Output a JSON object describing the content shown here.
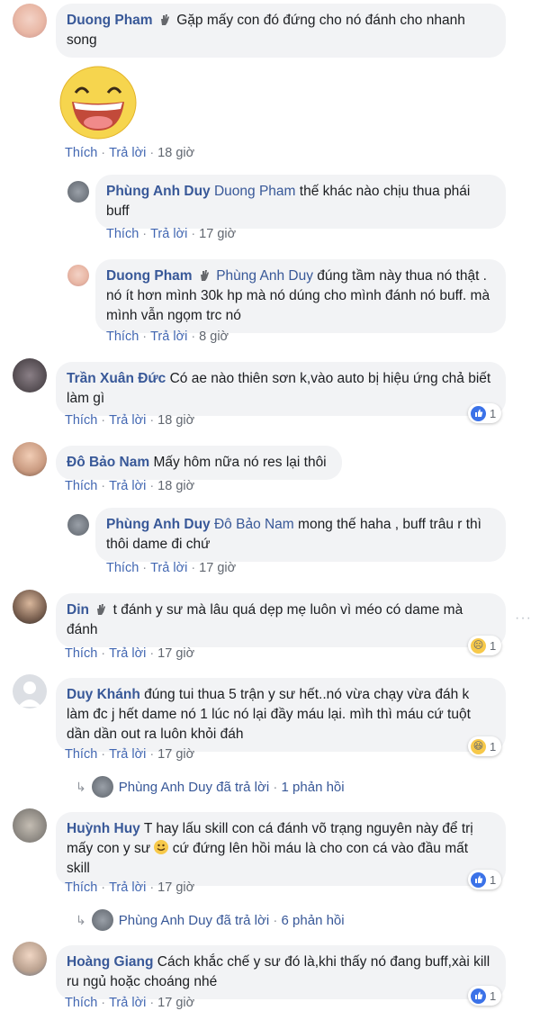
{
  "actions": {
    "like": "Thích",
    "reply": "Trả lời"
  },
  "comments": [
    {
      "name": "Duong Pham",
      "tag": "",
      "text": "Gặp mấy con đó đứng cho nó đánh cho nhanh song",
      "time": "18 giờ"
    },
    {
      "name": "Phùng Anh Duy",
      "tag": "Duong Pham",
      "text": "thế khác nào chịu thua phái buff",
      "time": "17 giờ"
    },
    {
      "name": "Duong Pham",
      "tag": "Phùng Anh Duy",
      "text": "đúng tầm này thua nó thật . nó ít hơn mình 30k hp mà nó dúng cho mình đánh nó buff. mà mình vẫn ngọm trc nó",
      "time": "8 giờ"
    },
    {
      "name": "Trần Xuân Đức",
      "tag": "",
      "text": "Có ae nào thiên sơn k,vào auto bị hiệu ứng chả biết làm gì",
      "time": "18 giờ",
      "reaction": "1"
    },
    {
      "name": "Đô Bảo Nam",
      "tag": "",
      "text": "Mấy hôm nữa nó res lại thôi",
      "time": "18 giờ"
    },
    {
      "name": "Phùng Anh Duy",
      "tag": "Đô Bảo Nam",
      "text": "mong thế haha , buff trâu r thì thôi dame đi chứ",
      "time": "17 giờ"
    },
    {
      "name": "Din",
      "tag": "",
      "text": "t đánh y sư mà lâu quá dẹp mẹ luôn vì méo có dame mà đánh",
      "time": "17 giờ",
      "reaction": "1"
    },
    {
      "name": "Duy Khánh",
      "tag": "",
      "text": "đúng tui thua 5 trận y sư hết..nó vừa chạy vừa đáh k làm đc j hết dame nó 1 lúc nó lại đầy máu lại. mìh thì máu cứ tuột dần dần out ra luôn khỏi đáh",
      "time": "17 giờ",
      "reaction": "1"
    },
    {
      "name": "Huỳnh Huy",
      "tag": "",
      "text_before": "T hay lấu skill con cá đánh võ trạng nguyên này để trị mấy con y sư",
      "text_after": "cứ đứng lên hồi máu là cho con cá vào đầu mất skill",
      "time": "17 giờ",
      "reaction": "1"
    },
    {
      "name": "Hoàng Giang",
      "tag": "",
      "text": "Cách khắc chế y sư đó là,khi thấy nó đang buff,xài kill ru ngủ hoặc choáng nhé",
      "time": "17 giờ",
      "reaction": "1"
    }
  ],
  "reply_summaries": [
    {
      "name": "Phùng Anh Duy",
      "action": "đã trả lời",
      "count": "1 phản hồi"
    },
    {
      "name": "Phùng Anh Duy",
      "action": "đã trả lời",
      "count": "6 phản hồi"
    }
  ],
  "more_options": "···",
  "colors": {
    "link": "#385898",
    "bubble": "#f2f3f5",
    "meta": "#616770",
    "like": "#3b72e8"
  }
}
